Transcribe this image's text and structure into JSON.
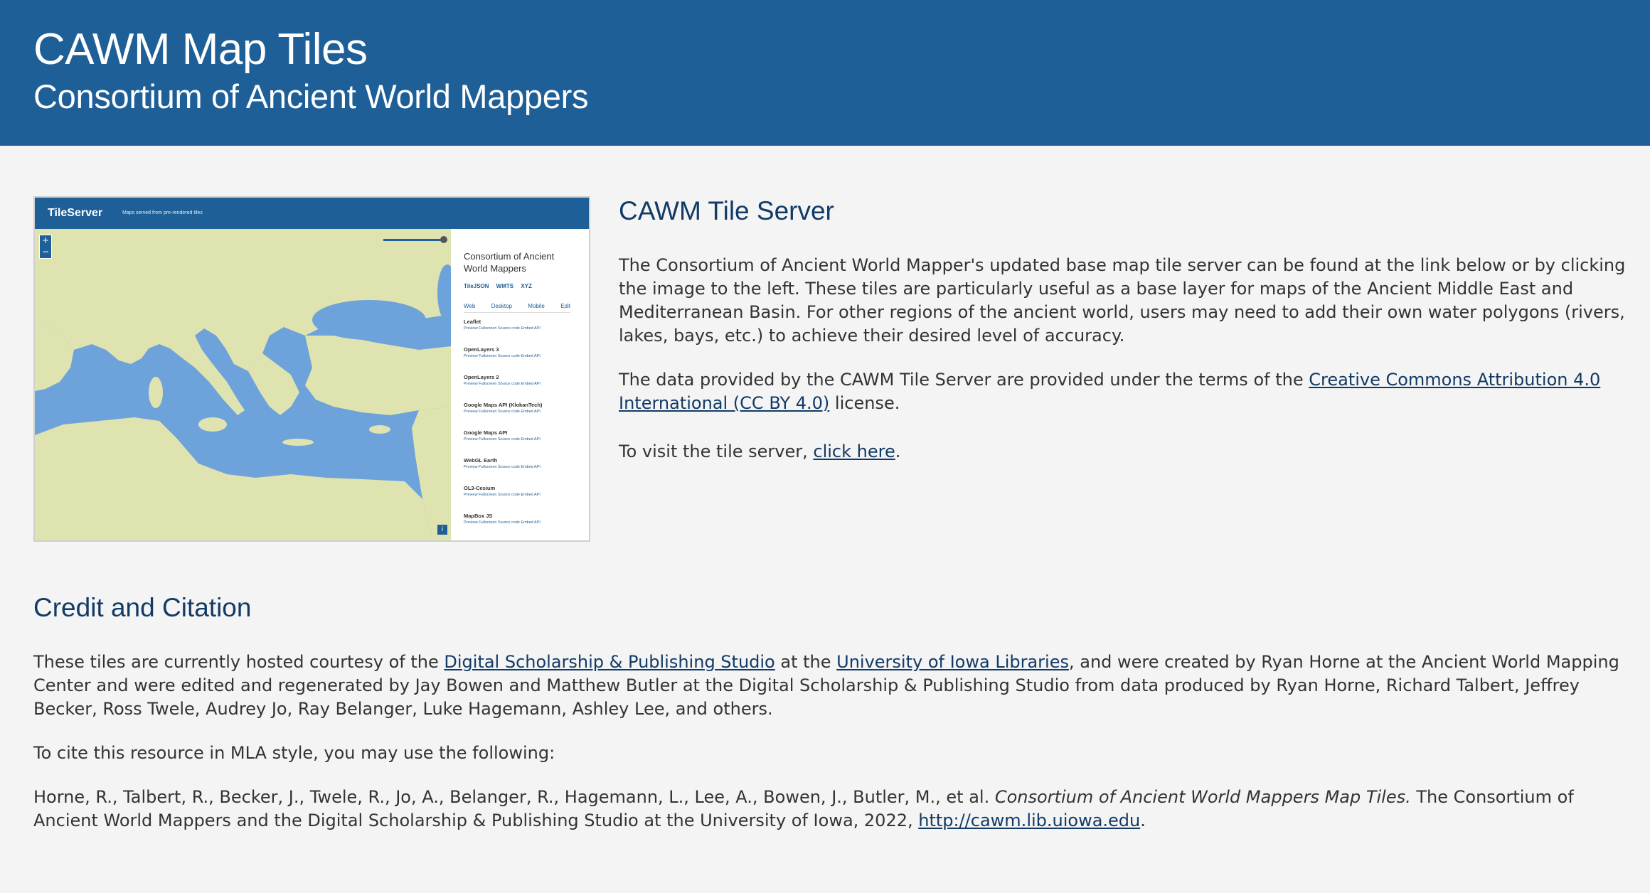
{
  "header": {
    "title": "CAWM Map Tiles",
    "subtitle": "Consortium of Ancient World Mappers"
  },
  "thumbnail": {
    "app_title": "TileServer",
    "app_subtitle": "Maps served from pre-rendered tiles",
    "zoom_in": "+",
    "zoom_out": "−",
    "info": "i",
    "panel_title": "Consortium of Ancient World Mappers",
    "panel_links": [
      "TileJSON",
      "WMTS",
      "XYZ"
    ],
    "panel_tabs": [
      "Web",
      "Desktop",
      "Mobile",
      "Edit"
    ],
    "panel_item_links": "Preview  Fullscreen  Source code  Embed  API",
    "panel_items": [
      "Leaflet",
      "OpenLayers 3",
      "OpenLayers 2",
      "Google Maps API (KlokanTech)",
      "Google Maps API",
      "WebGL Earth",
      "OL3-Cesium",
      "MapBox JS"
    ]
  },
  "tile_server": {
    "heading": "CAWM Tile Server",
    "p1": "The Consortium of Ancient World Mapper's updated base map tile server can be found at the link below or by clicking the image to the left. These tiles are particularly useful as a base layer for maps of the Ancient Middle East and Mediterranean Basin. For other regions of the ancient world, users may need to add their own water polygons (rivers, lakes, bays, etc.) to achieve their desired level of accuracy.",
    "p2_before": "The data provided by the CAWM Tile Server are provided under the terms of the ",
    "p2_link": "Creative Commons Attribution 4.0 International (CC BY 4.0)",
    "p2_after": " license.",
    "p3_before": "To visit the tile server, ",
    "p3_link": "click here",
    "p3_after": "."
  },
  "credit": {
    "heading": "Credit and Citation",
    "p1_a": "These tiles are currently hosted courtesy of the ",
    "p1_link1": "Digital Scholarship & Publishing Studio",
    "p1_b": " at the ",
    "p1_link2": "University of Iowa Libraries",
    "p1_c": ", and were created by Ryan Horne at the Ancient World Mapping Center and were edited and regenerated by Jay Bowen and Matthew Butler at the Digital Scholarship & Publishing Studio from data produced by Ryan Horne, Richard Talbert, Jeffrey Becker, Ross Twele, Audrey Jo, Ray Belanger, Luke Hagemann, Ashley Lee, and others.",
    "p2": "To cite this resource in MLA style, you may use the following:",
    "p3_a": "Horne, R., Talbert, R., Becker, J., Twele, R., Jo, A., Belanger, R., Hagemann, L., Lee, A., Bowen, J., Butler, M., et al. ",
    "p3_italic": "Consortium of Ancient World Mappers Map Tiles.",
    "p3_b": " The Consortium of Ancient World Mappers and the Digital Scholarship & Publishing Studio at the University of Iowa, 2022, ",
    "p3_link": "http://cawm.lib.uiowa.edu",
    "p3_c": "."
  },
  "colors": {
    "banner": "#1e5f98",
    "heading": "#123a66",
    "background": "#f4f4f4",
    "sea": "#6ea2db",
    "land": "#dfe3b0"
  }
}
